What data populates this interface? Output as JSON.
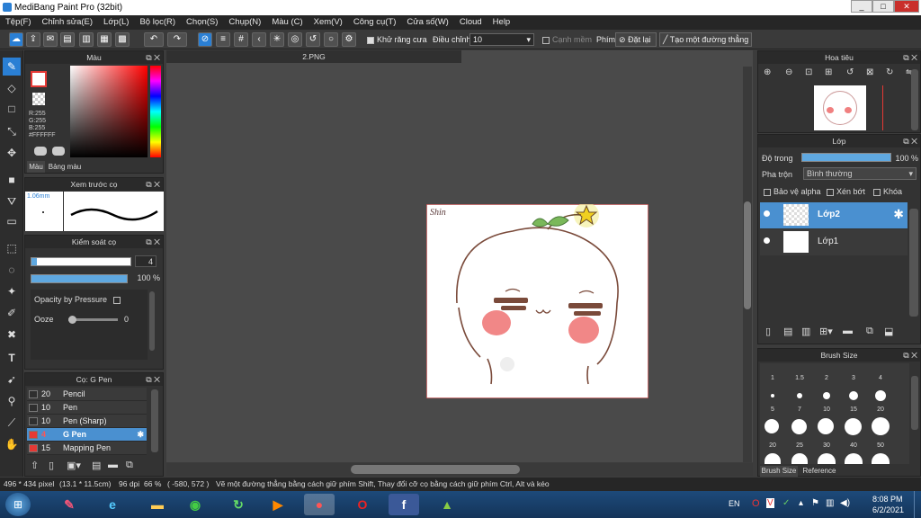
{
  "window": {
    "title": "MediBang Paint Pro (32bit)",
    "minimize": "_",
    "maximize": "□",
    "close": "✕"
  },
  "menu": [
    "Tệp(F)",
    "Chỉnh sửa(E)",
    "Lớp(L)",
    "Bộ lọc(R)",
    "Chọn(S)",
    "Chụp(N)",
    "Màu (C)",
    "Xem(V)",
    "Công cụ(T)",
    "Cửa số(W)",
    "Cloud",
    "Help"
  ],
  "toolbar": {
    "antialias_label": "Khử răng cưa",
    "adjust_label": "Điều chỉnh",
    "adjust_value": "10",
    "edge_label": "Cạnh mềm",
    "key_label": "Phím",
    "reset_label": "Đặt lại",
    "line_label": "Tạo một đường thẳng"
  },
  "color_panel": {
    "title": "Màu",
    "r": "R:255",
    "g": "G:255",
    "b": "B:255",
    "hex": "#FFFFFF",
    "tab_color": "Màu",
    "tab_palette": "Bảng màu",
    "primary_color": "#ffffff",
    "accent_color": "#e53935"
  },
  "brush_preview": {
    "title": "Xem trước cọ",
    "size": "1.06mm"
  },
  "brush_control": {
    "title": "Kiểm soát cọ",
    "size_value": "4",
    "opacity_value": "100 %",
    "opacity_fraction": 1.0,
    "pressure_label": "Opacity by Pressure",
    "ooze_label": "Ooze",
    "ooze_value": "0"
  },
  "brush_list": {
    "title": "Cọ: G Pen",
    "items": [
      {
        "size": "20",
        "name": "Pencil"
      },
      {
        "size": "10",
        "name": "Pen"
      },
      {
        "size": "10",
        "name": "Pen (Sharp)"
      },
      {
        "size": "4",
        "name": "G Pen",
        "selected": true
      },
      {
        "size": "15",
        "name": "Mapping Pen"
      }
    ]
  },
  "document": {
    "tab_name": "2.PNG",
    "signature_text": "Shin"
  },
  "navigator": {
    "title": "Hoa tiêu"
  },
  "layer_panel": {
    "title": "Lớp",
    "opacity_label": "Độ trong",
    "opacity_value": "100 %",
    "blend_label": "Pha trộn",
    "blend_value": "Bình thường",
    "protect_alpha": "Bảo vệ alpha",
    "clipping": "Xén bớt",
    "lock": "Khóa",
    "layers": [
      {
        "name": "Lớp2",
        "selected": true
      },
      {
        "name": "Lớp1",
        "selected": false
      }
    ]
  },
  "brush_size_panel": {
    "title": "Brush Size",
    "row1": [
      "1",
      "1.5",
      "2",
      "3",
      "4"
    ],
    "row2": [
      "5",
      "7",
      "10",
      "15",
      "20"
    ],
    "row3": [
      "20",
      "25",
      "30",
      "40",
      "50"
    ],
    "tab_brush_size": "Brush Size",
    "tab_reference": "Reference"
  },
  "status": {
    "canvas_size": "496 * 434 pixel",
    "physical": "(13.1 * 11.5cm)",
    "dpi": "96 dpi",
    "zoom": "66 %",
    "coords": "( -580, 572 )",
    "hint": "Vẽ một đường thẳng bằng cách giữ phím Shift, Thay đổi cỡ cọ bằng cách giữ phím Ctrl, Alt và kéo"
  },
  "taskbar": {
    "lang": "EN",
    "time": "8:08 PM",
    "date": "6/2/2021"
  }
}
